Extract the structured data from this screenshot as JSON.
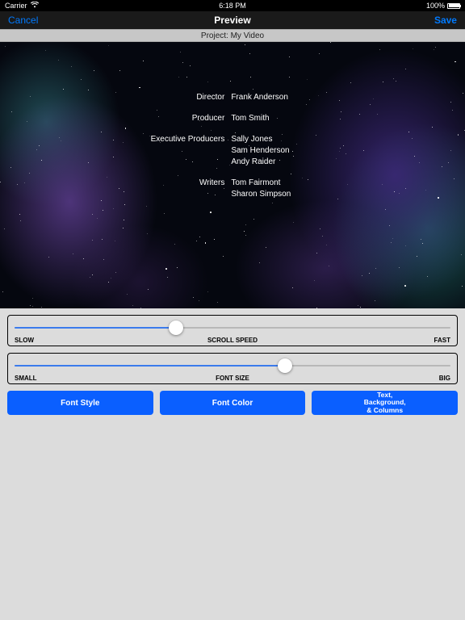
{
  "status": {
    "carrier": "Carrier",
    "time": "6:18 PM",
    "battery": "100%"
  },
  "nav": {
    "cancel": "Cancel",
    "title": "Preview",
    "save": "Save"
  },
  "project": {
    "label": "Project: My Video"
  },
  "credits": [
    {
      "role": "Director",
      "names": [
        "Frank Anderson"
      ]
    },
    {
      "role": "Producer",
      "names": [
        "Tom Smith"
      ]
    },
    {
      "role": "Executive Producers",
      "names": [
        "Sally Jones",
        "Sam Henderson",
        "Andy Raider"
      ]
    },
    {
      "role": "Writers",
      "names": [
        "Tom Fairmont",
        "Sharon Simpson"
      ]
    }
  ],
  "sliders": {
    "speed": {
      "leftLabel": "SLOW",
      "centerLabel": "SCROLL SPEED",
      "rightLabel": "FAST",
      "valuePct": 37
    },
    "size": {
      "leftLabel": "SMALL",
      "centerLabel": "FONT SIZE",
      "rightLabel": "BIG",
      "valuePct": 62
    }
  },
  "buttons": {
    "fontStyle": "Font Style",
    "fontColor": "Font Color",
    "textBgCols": "Text,\nBackground,\n& Columns"
  }
}
